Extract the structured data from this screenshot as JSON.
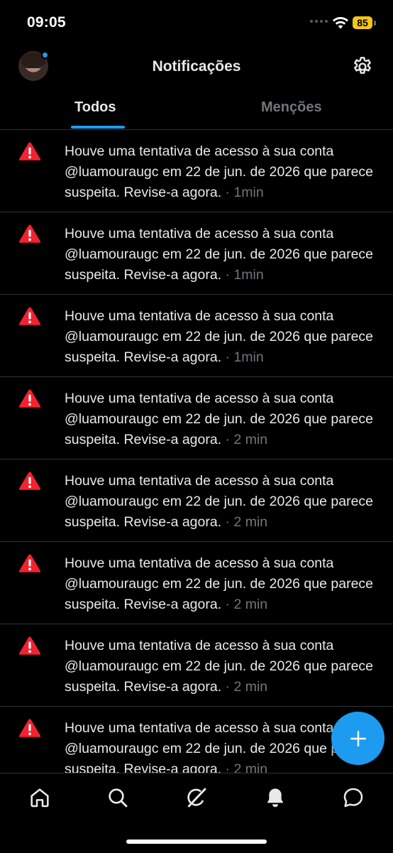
{
  "status_bar": {
    "time": "09:05",
    "battery": "85"
  },
  "header": {
    "title": "Notificações"
  },
  "tabs": [
    {
      "label": "Todos",
      "active": true
    },
    {
      "label": "Menções",
      "active": false
    }
  ],
  "notifications": [
    {
      "text": "Houve uma tentativa de acesso à sua conta @luamouraugc em 22 de jun. de 2026 que parece suspeita. Revise-a agora.",
      "time": " · 1min"
    },
    {
      "text": "Houve uma tentativa de acesso à sua conta @luamouraugc em 22 de jun. de 2026 que parece suspeita. Revise-a agora.",
      "time": " · 1min"
    },
    {
      "text": "Houve uma tentativa de acesso à sua conta @luamouraugc em 22 de jun. de 2026 que parece suspeita. Revise-a agora.",
      "time": " · 1min"
    },
    {
      "text": "Houve uma tentativa de acesso à sua conta @luamouraugc em 22 de jun. de 2026 que parece suspeita. Revise-a agora.",
      "time": " · 2 min"
    },
    {
      "text": "Houve uma tentativa de acesso à sua conta @luamouraugc em 22 de jun. de 2026 que parece suspeita. Revise-a agora.",
      "time": " · 2 min"
    },
    {
      "text": "Houve uma tentativa de acesso à sua conta @luamouraugc em 22 de jun. de 2026 que parece suspeita. Revise-a agora.",
      "time": " · 2 min"
    },
    {
      "text": "Houve uma tentativa de acesso à sua conta @luamouraugc em 22 de jun. de 2026 que parece suspeita. Revise-a agora.",
      "time": " · 2 min"
    },
    {
      "text": "Houve uma tentativa de acesso à sua conta @luamouraugc em 22 de jun. de 2026 que parece suspeita. Revise-a agora.",
      "time": " · 2 min"
    }
  ],
  "icons": {
    "notification": "warning-icon",
    "settings": "gear-icon",
    "fab": "plus-icon",
    "nav": [
      "home-icon",
      "search-icon",
      "grok-icon",
      "bell-icon",
      "messages-icon"
    ]
  },
  "colors": {
    "accent": "#1d9bf0",
    "warning": "#f4212e",
    "battery": "#f5c518",
    "muted": "#71767b"
  }
}
